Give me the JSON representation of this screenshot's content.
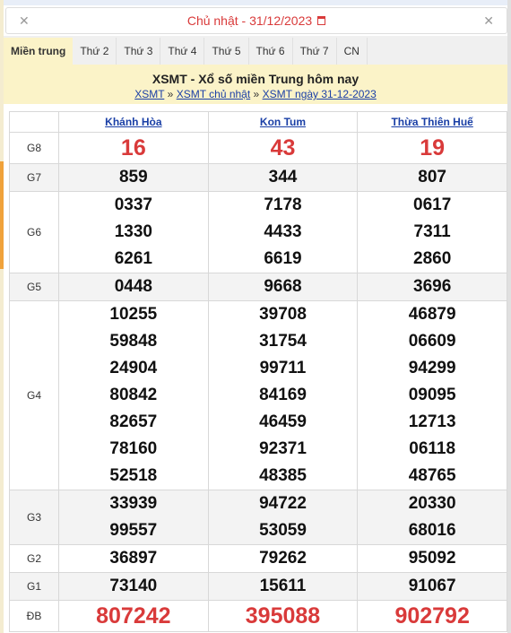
{
  "date_bar": {
    "label": "Chủ nhật -  31/12/2023"
  },
  "tabs": [
    "Miền trung",
    "Thứ 2",
    "Thứ 3",
    "Thứ 4",
    "Thứ 5",
    "Thứ 6",
    "Thứ 7",
    "CN"
  ],
  "header": {
    "title": "XSMT - Xổ số miền Trung hôm nay",
    "breadcrumb": [
      "XSMT",
      "XSMT chủ nhật",
      "XSMT ngày 31-12-2023"
    ],
    "separator": "»"
  },
  "table": {
    "provinces": [
      "Khánh Hòa",
      "Kon Tum",
      "Thừa Thiên Huế"
    ],
    "prizes": [
      {
        "label": "G8",
        "values": [
          [
            "16"
          ],
          [
            "43"
          ],
          [
            "19"
          ]
        ]
      },
      {
        "label": "G7",
        "values": [
          [
            "859"
          ],
          [
            "344"
          ],
          [
            "807"
          ]
        ]
      },
      {
        "label": "G6",
        "values": [
          [
            "0337",
            "1330",
            "6261"
          ],
          [
            "7178",
            "4433",
            "6619"
          ],
          [
            "0617",
            "7311",
            "2860"
          ]
        ]
      },
      {
        "label": "G5",
        "values": [
          [
            "0448"
          ],
          [
            "9668"
          ],
          [
            "3696"
          ]
        ]
      },
      {
        "label": "G4",
        "values": [
          [
            "10255",
            "59848",
            "24904",
            "80842",
            "82657",
            "78160",
            "52518"
          ],
          [
            "39708",
            "31754",
            "99711",
            "84169",
            "46459",
            "92371",
            "48385"
          ],
          [
            "46879",
            "06609",
            "94299",
            "09095",
            "12713",
            "06118",
            "48765"
          ]
        ]
      },
      {
        "label": "G3",
        "values": [
          [
            "33939",
            "99557"
          ],
          [
            "94722",
            "53059"
          ],
          [
            "20330",
            "68016"
          ]
        ]
      },
      {
        "label": "G2",
        "values": [
          [
            "36897"
          ],
          [
            "79262"
          ],
          [
            "95092"
          ]
        ]
      },
      {
        "label": "G1",
        "values": [
          [
            "73140"
          ],
          [
            "15611"
          ],
          [
            "91067"
          ]
        ]
      },
      {
        "label": "ĐB",
        "values": [
          [
            "807242"
          ],
          [
            "395088"
          ],
          [
            "902792"
          ]
        ]
      }
    ]
  },
  "colors": {
    "accent_red": "#d93a3a",
    "link_blue": "#1a3fa6",
    "header_bg": "#fbf3c8"
  }
}
